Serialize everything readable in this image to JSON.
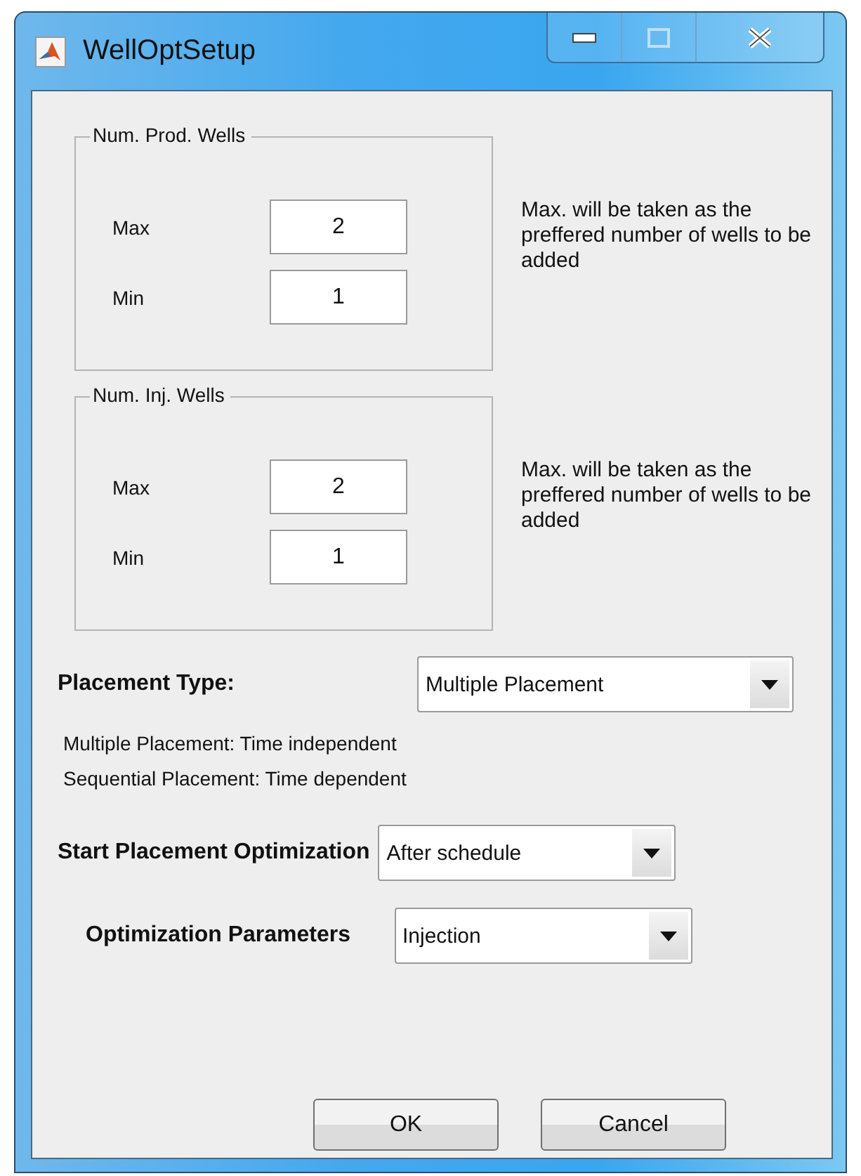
{
  "window": {
    "title": "WellOptSetup"
  },
  "groups": [
    {
      "title": "Num. Prod. Wells",
      "fields": [
        {
          "label": "Max",
          "value": "2"
        },
        {
          "label": "Min",
          "value": "1"
        }
      ],
      "note": "Max. will be taken as the preffered number of wells to be added"
    },
    {
      "title": "Num. Inj. Wells",
      "fields": [
        {
          "label": "Max",
          "value": "2"
        },
        {
          "label": "Min",
          "value": "1"
        }
      ],
      "note": "Max. will be taken as the preffered number of wells to be added"
    }
  ],
  "placement_type": {
    "label": "Placement Type:",
    "value": "Multiple Placement"
  },
  "placement_help": [
    "Multiple Placement: Time independent",
    "Sequential Placement: Time dependent"
  ],
  "start_optimization": {
    "label": "Start Placement Optimization",
    "value": "After schedule"
  },
  "optimization_parameters": {
    "label": "Optimization Parameters",
    "value": "Injection"
  },
  "buttons": [
    "OK",
    "Cancel"
  ]
}
